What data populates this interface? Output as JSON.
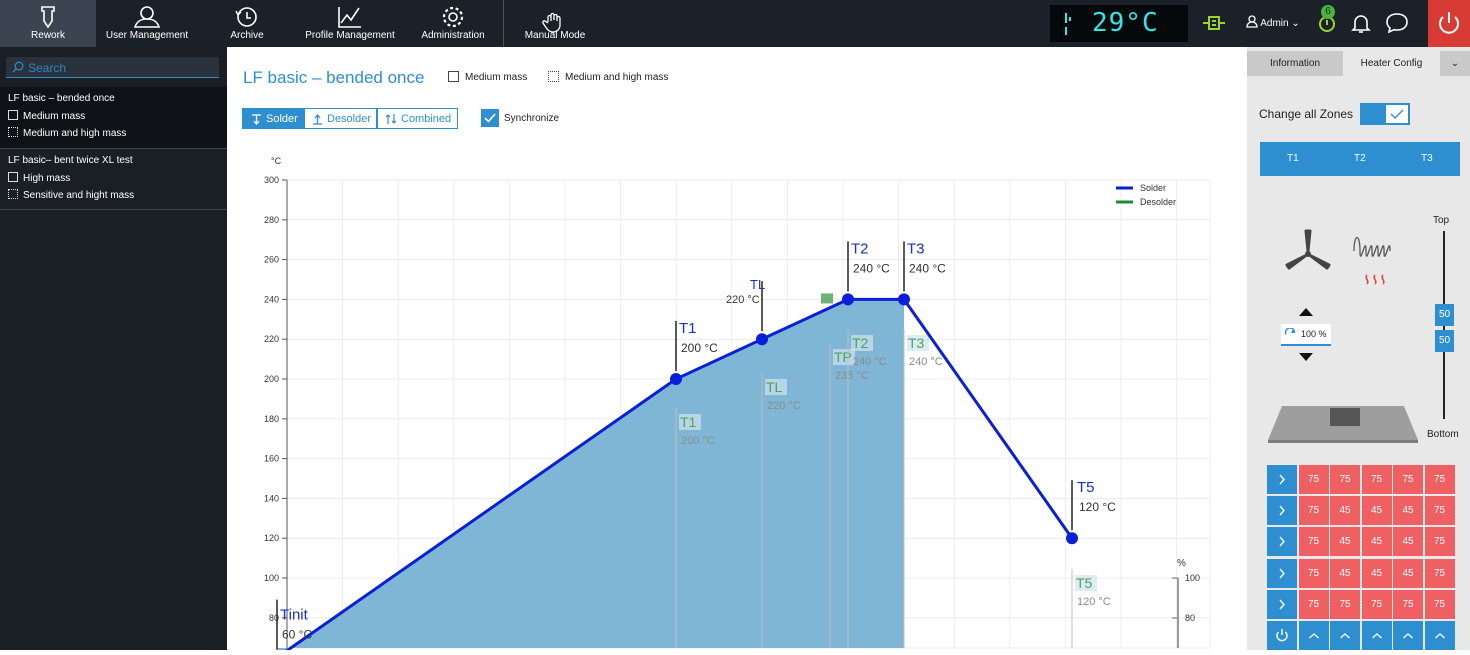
{
  "nav": {
    "items": [
      {
        "label": "Rework",
        "icon": "solder-iron-icon"
      },
      {
        "label": "User Management",
        "icon": "users-icon"
      },
      {
        "label": "Archive",
        "icon": "history-icon"
      },
      {
        "label": "Profile Management",
        "icon": "chart-icon"
      },
      {
        "label": "Administration",
        "icon": "gear-icon"
      },
      {
        "label": "Manual Mode",
        "icon": "hand-icon"
      }
    ],
    "temperature": "29°C",
    "user": "Admin",
    "badge_count": "6",
    "colors": {
      "bar": "#1b2129",
      "accent": "#2fe6e6",
      "power": "#d83a34",
      "badge": "#49b33b"
    }
  },
  "sidebar": {
    "search_placeholder": "Search",
    "groups": [
      {
        "title": "LF basic – bended once",
        "items": [
          "Medium mass",
          "Medium and high mass"
        ]
      },
      {
        "title": "LF basic– bent twice XL test",
        "items": [
          "High mass",
          "Sensitive and hight mass"
        ]
      }
    ]
  },
  "profile": {
    "title": "LF basic – bended once",
    "chips": [
      "Medium mass",
      "Medium and high mass"
    ],
    "modes": [
      "Solder",
      "Desolder",
      "Combined"
    ],
    "active_mode": "Solder",
    "synchronize": "Synchronize"
  },
  "chart_data": {
    "type": "area",
    "ylabel": "°C",
    "yticks": [
      80,
      100,
      120,
      140,
      160,
      180,
      200,
      220,
      240,
      260,
      280,
      300
    ],
    "ylim": [
      80,
      300
    ],
    "legend": [
      "Solder",
      "Desolder"
    ],
    "legend_position": "top-right",
    "series": [
      {
        "name": "Solder",
        "color": "#0a1fd8",
        "points": [
          {
            "label": "Tinit",
            "value": "60 °C",
            "y": 60
          },
          {
            "label": "T1",
            "value": "200 °C",
            "y": 200
          },
          {
            "label": "TL",
            "value": "220 °C",
            "y": 220
          },
          {
            "label": "T2",
            "value": "240 °C",
            "y": 240
          },
          {
            "label": "T3",
            "value": "240 °C",
            "y": 240
          },
          {
            "label": "T5",
            "value": "120 °C",
            "y": 120
          }
        ]
      },
      {
        "name": "Desolder",
        "color": "#1c8a2c",
        "points": [
          {
            "label": "T1",
            "value": "200 °C"
          },
          {
            "label": "TL",
            "value": "220 °C"
          },
          {
            "label": "TP",
            "value": "235 °C"
          },
          {
            "label": "T2",
            "value": "240 °C"
          },
          {
            "label": "T3",
            "value": "240 °C"
          },
          {
            "label": "T5",
            "value": "120 °C"
          }
        ]
      }
    ],
    "secondary_axis": {
      "label": "%",
      "ticks": [
        100,
        80
      ]
    }
  },
  "heater": {
    "tabs": [
      "Information",
      "Heater Config"
    ],
    "active_tab": "Heater Config",
    "change_all_zones": "Change all Zones",
    "zones": [
      "T1",
      "T2",
      "T3"
    ],
    "fan_percent": "100 %",
    "top_label": "Top",
    "bottom_label": "Bottom",
    "slider_values": [
      "50",
      "50"
    ],
    "grid": [
      [
        "75",
        "75",
        "75",
        "75",
        "75"
      ],
      [
        "75",
        "45",
        "45",
        "45",
        "75"
      ],
      [
        "75",
        "45",
        "45",
        "45",
        "75"
      ],
      [
        "75",
        "45",
        "45",
        "45",
        "75"
      ],
      [
        "75",
        "75",
        "75",
        "75",
        "75"
      ]
    ]
  }
}
